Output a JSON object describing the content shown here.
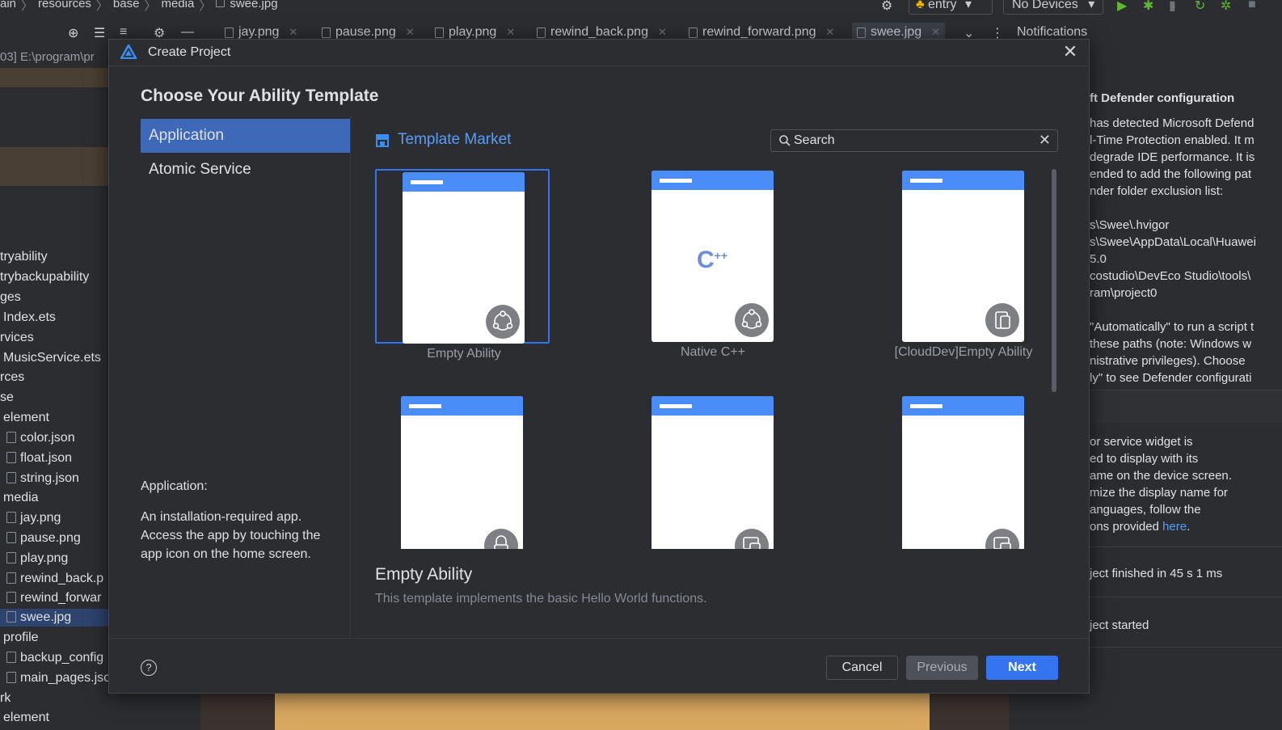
{
  "breadcrumbs": [
    "ain",
    "resources",
    "base",
    "media",
    "swee.jpg"
  ],
  "toolbar": {
    "run_config": "entry",
    "device": "No Devices"
  },
  "tabs": [
    {
      "label": "jay.png"
    },
    {
      "label": "pause.png"
    },
    {
      "label": "play.png"
    },
    {
      "label": "rewind_back.png"
    },
    {
      "label": "rewind_forward.png"
    },
    {
      "label": "swee.jpg",
      "active": true
    }
  ],
  "notifications_tab": "Notifications",
  "project_path": "03] E:\\program\\pr",
  "tree": [
    "tryability",
    "trybackupability",
    "ges",
    "Index.ets",
    "rvices",
    "MusicService.ets",
    "rces",
    "se",
    "element",
    "color.json",
    "float.json",
    "string.json",
    "media",
    "jay.png",
    "pause.png",
    "play.png",
    "rewind_back.p",
    "rewind_forwar",
    "swee.jpg",
    "profile",
    "backup_config",
    "main_pages.jso",
    "rk",
    "element"
  ],
  "notif": {
    "defender_title": "ft Defender configuration",
    "defender_lines": [
      "has detected Microsoft Defend",
      "l-Time Protection enabled. It m",
      " degrade IDE performance. It is",
      "ended to add the following pat",
      "nder folder exclusion list:",
      "",
      "s\\Swee\\.hvigor",
      "s\\Swee\\AppData\\Local\\Huawei",
      "5.0",
      "costudio\\DevEco Studio\\tools\\",
      "ram\\project0",
      "",
      "\"Automatically\" to run a script t",
      " these paths (note: Windows w",
      "nistrative privileges). Choose",
      "ly\" to see Defender configurati"
    ],
    "widget_lines": [
      " or service widget is",
      "ed to display with its",
      "ame on the device screen.",
      "mize the display name for",
      "anguages, follow the",
      "ons provided "
    ],
    "widget_link": "here",
    "finished": "ject finished in 45 s 1 ms",
    "started": "ject started"
  },
  "dialog": {
    "title": "Create Project",
    "heading": "Choose Your Ability Template",
    "categories": [
      {
        "label": "Application",
        "selected": true
      },
      {
        "label": "Atomic Service",
        "selected": false
      }
    ],
    "market_label": "Template Market",
    "search_placeholder": "Search",
    "templates": [
      {
        "label": "Empty Ability",
        "icon": "share-nodes-icon",
        "selected": true
      },
      {
        "label": "Native C++",
        "icon": "share-nodes-icon",
        "selected": false
      },
      {
        "label": "[CloudDev]Empty Ability",
        "icon": "cloud-device-icon",
        "selected": false
      },
      {
        "label": "",
        "icon": "lock-icon",
        "selected": false
      },
      {
        "label": "",
        "icon": "device-widget-icon",
        "selected": false
      },
      {
        "label": "",
        "icon": "device-widget-icon",
        "selected": false
      }
    ],
    "desc_title": "Application:",
    "desc_body": "An installation-required app. Access the app by touching the app icon on the home screen.",
    "selected_name": "Empty Ability",
    "selected_desc": "This template implements the basic Hello World functions.",
    "cancel": "Cancel",
    "previous": "Previous",
    "next": "Next",
    "help": "?"
  },
  "colors": {
    "accent": "#3574f0",
    "phone_bar": "#4b8df8",
    "market": "#5a9cf8"
  }
}
